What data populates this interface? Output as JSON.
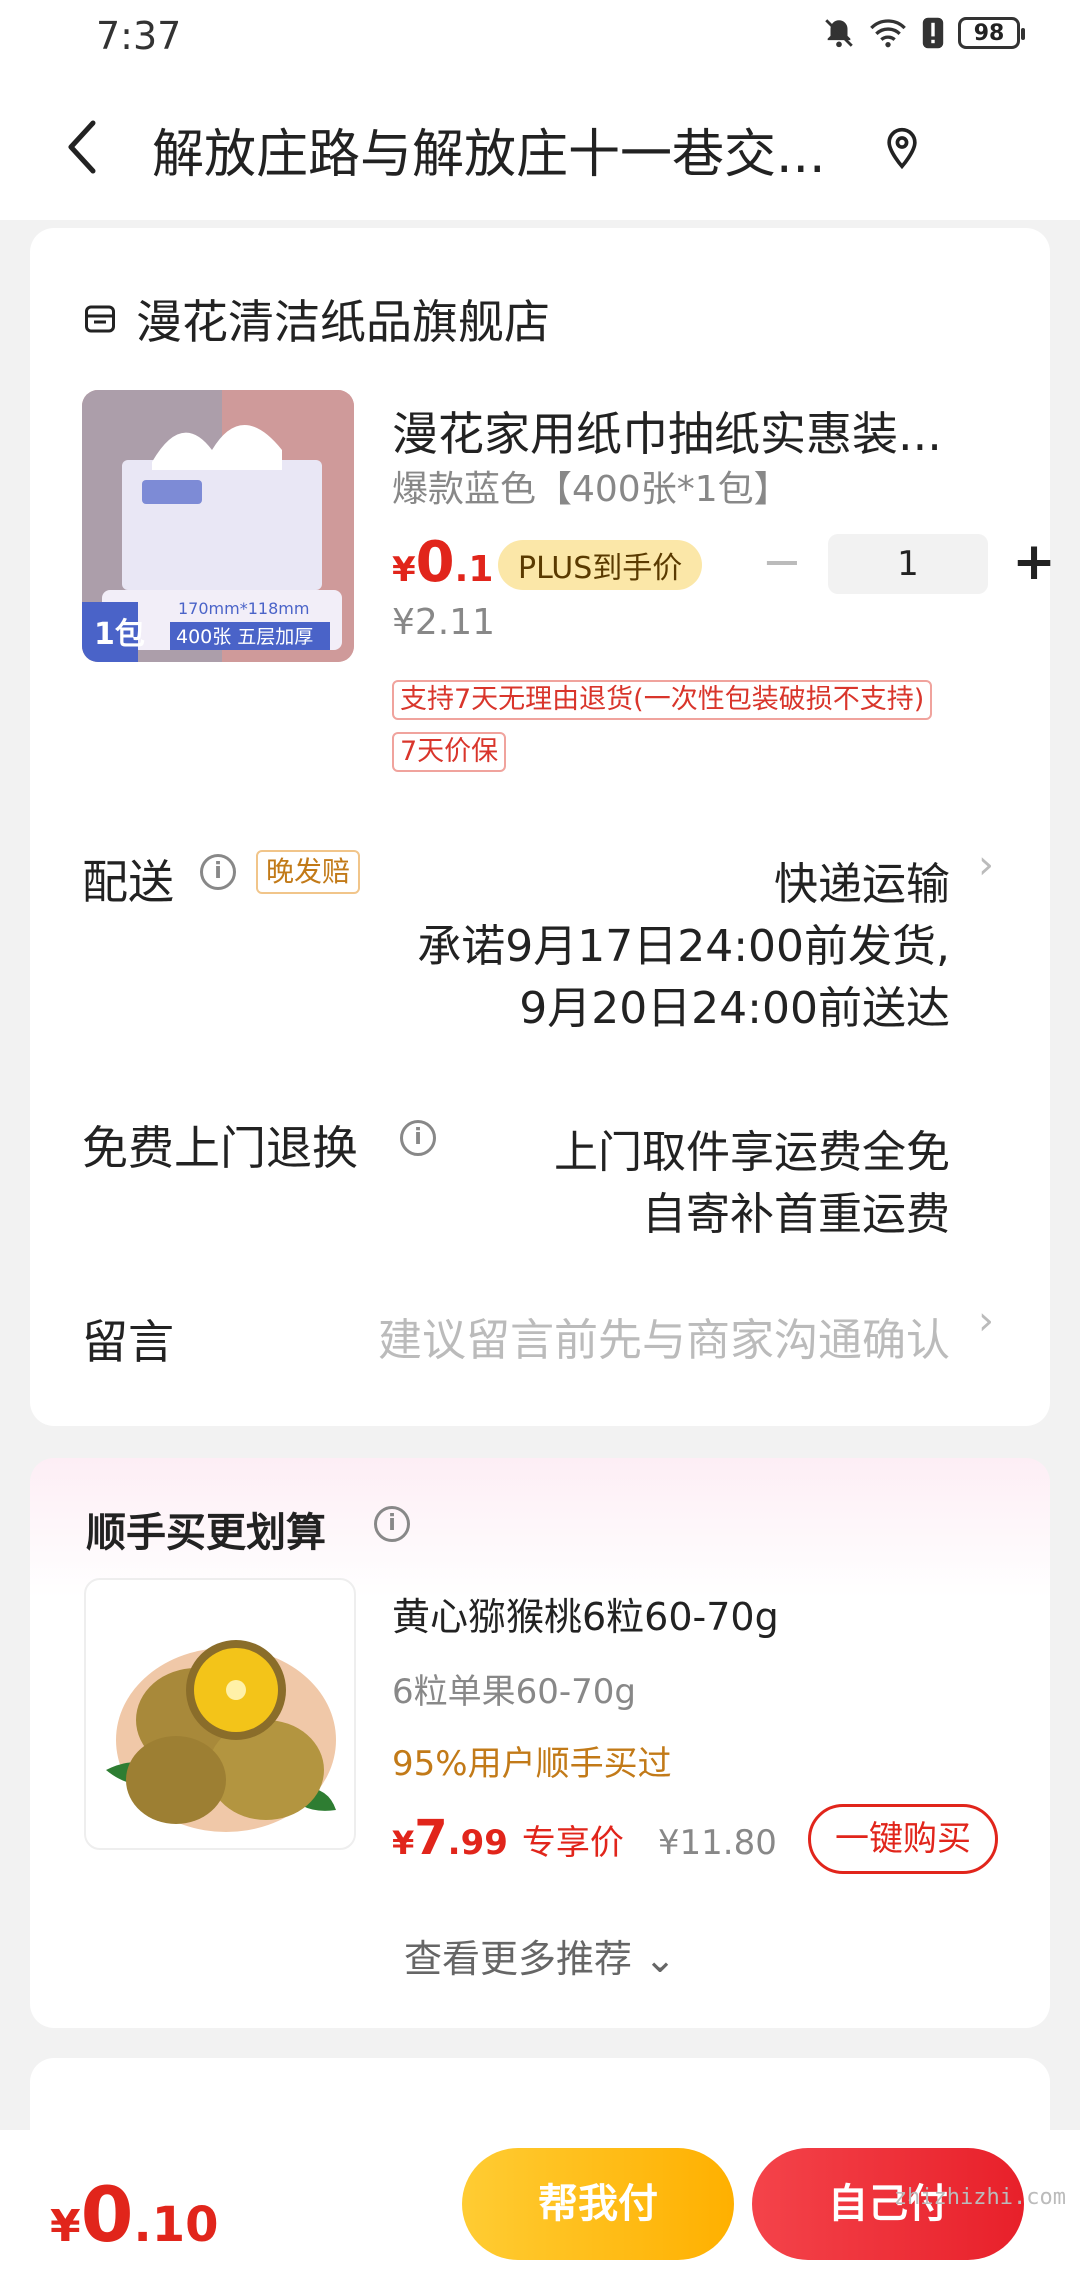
{
  "status_bar": {
    "time": "7:37",
    "battery": "98"
  },
  "header": {
    "title": "解放庄路与解放庄十一巷交..."
  },
  "shop": {
    "name": "漫花清洁纸品旗舰店"
  },
  "product": {
    "title": "漫花家用纸巾抽纸实惠装...",
    "spec": "爆款蓝色【400张*1包】",
    "price_yen": "¥",
    "price_int": "0",
    "price_dec": ".1",
    "plus_tag": "PLUS到手价",
    "original_price": "¥2.11",
    "quantity": "1",
    "tags": [
      "支持7天无理由退货(一次性包装破损不支持)",
      "7天价保"
    ],
    "image_text": {
      "size": "170mm*118mm",
      "count": "400张 五层加厚",
      "pack": "1包"
    }
  },
  "delivery": {
    "label": "配送",
    "late_tag": "晚发赔",
    "method": "快递运输",
    "promise_line1": "承诺9月17日24:00前发货,",
    "promise_line2": "9月20日24:00前送达"
  },
  "return_service": {
    "label": "免费上门退换",
    "line1": "上门取件享运费全免",
    "line2": "自寄补首重运费"
  },
  "message": {
    "label": "留言",
    "placeholder": "建议留言前先与商家沟通确认"
  },
  "recommend": {
    "title": "顺手买更划算",
    "item_name": "黄心猕猴桃6粒60-70g",
    "item_spec": "6粒单果60-70g",
    "item_hint": "95%用户顺手买过",
    "price_yen": "¥",
    "price_int": "7",
    "price_dec": ".99",
    "exclusive_label": "专享价",
    "original_price": "¥11.80",
    "buy_button": "一键购买",
    "more_link": "查看更多推荐 ⌄"
  },
  "bottom": {
    "total_yen": "¥",
    "total_int": "0",
    "total_dec": ".10",
    "help_pay": "帮我付",
    "self_pay": "自己付"
  },
  "watermark": "zhizhizhi.com",
  "colors": {
    "accent_red": "#e1251b",
    "help_yellow": "#ffb000",
    "late_tag": "#c27a18"
  }
}
